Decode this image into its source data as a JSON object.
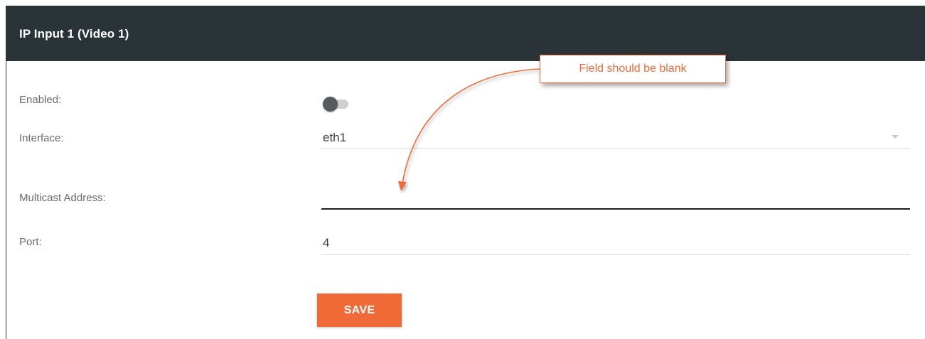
{
  "header": {
    "title": "IP Input 1 (Video 1)"
  },
  "form": {
    "enabled_label": "Enabled:",
    "enabled_value": false,
    "interface_label": "Interface:",
    "interface_value": "eth1",
    "multicast_label": "Multicast Address:",
    "multicast_value": "",
    "port_label": "Port:",
    "port_value": "4",
    "save_label": "SAVE"
  },
  "annotation": {
    "text": "Field should be blank"
  },
  "colors": {
    "header_bg": "#2a3338",
    "accent": "#f06a37",
    "label": "#6b6b6b"
  }
}
